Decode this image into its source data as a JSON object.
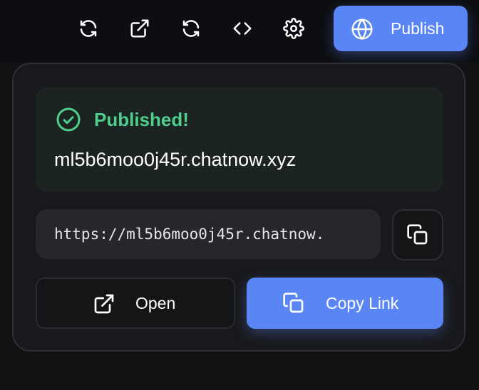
{
  "toolbar": {
    "icons": [
      "refresh-icon",
      "external-link-icon",
      "refresh-icon",
      "code-icon",
      "gear-icon"
    ],
    "publish_label": "Publish"
  },
  "publish_panel": {
    "status_title": "Published!",
    "domain": "ml5b6moo0j45r.chatnow.xyz",
    "url": "https://ml5b6moo0j45r.chatnow.",
    "open_label": "Open",
    "copy_link_label": "Copy Link"
  },
  "colors": {
    "accent": "#5a86f5",
    "success": "#4ecf8e",
    "background": "#121214",
    "panel": "#18191c"
  }
}
